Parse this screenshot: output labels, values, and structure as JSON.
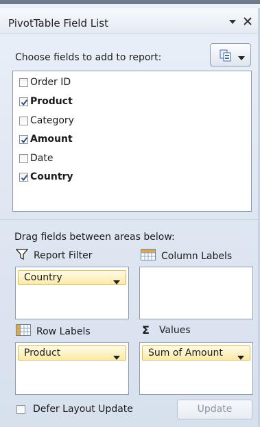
{
  "panel": {
    "title": "PivotTable Field List",
    "title_dropdown_icon": "chevron-down-icon",
    "close_icon": "close-icon"
  },
  "chooser": {
    "label": "Choose fields to add to report:",
    "layout_button_icon": "layout-icon"
  },
  "fields": [
    {
      "name": "Order ID",
      "checked": false
    },
    {
      "name": "Product",
      "checked": true
    },
    {
      "name": "Category",
      "checked": false
    },
    {
      "name": "Amount",
      "checked": true
    },
    {
      "name": "Date",
      "checked": false
    },
    {
      "name": "Country",
      "checked": true
    }
  ],
  "areas": {
    "instruction": "Drag fields between areas below:",
    "report_filter": {
      "label": "Report Filter",
      "icon": "filter-icon",
      "items": [
        "Country"
      ]
    },
    "column_labels": {
      "label": "Column Labels",
      "icon": "column-grid-icon",
      "items": []
    },
    "row_labels": {
      "label": "Row Labels",
      "icon": "row-grid-icon",
      "items": [
        "Product"
      ]
    },
    "values": {
      "label": "Values",
      "icon": "sigma-icon",
      "symbol": "Σ",
      "items": [
        "Sum of Amount"
      ]
    }
  },
  "footer": {
    "defer_label": "Defer Layout Update",
    "defer_checked": false,
    "update_label": "Update"
  },
  "colors": {
    "panel_bg": "#dfe7f2",
    "border": "#8d9ab0",
    "chip_bg": "#fbeaa9",
    "chip_border": "#e2b94c"
  }
}
